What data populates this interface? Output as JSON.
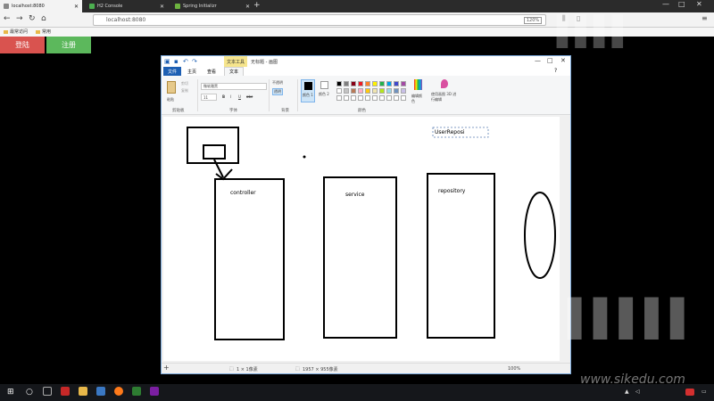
{
  "browser": {
    "tabs": [
      {
        "title": "localhost:8080",
        "active": true
      },
      {
        "title": "H2 Console",
        "active": false
      },
      {
        "title": "Spring Initializr",
        "active": false
      }
    ],
    "new_tab": "+",
    "url": "localhost:8080",
    "zoom": "120%",
    "bookmarks": [
      "最常访问",
      "常用"
    ],
    "window_controls": [
      "—",
      "□",
      "✕"
    ]
  },
  "page": {
    "login_button": "登陆",
    "register_button": "注册",
    "login_color": "#d9534f",
    "register_color": "#5cb85c"
  },
  "paint": {
    "context_tab": "文本工具",
    "title": "无标题 - 画图",
    "tabs": [
      "文件",
      "主页",
      "查看",
      "文本"
    ],
    "ribbon": {
      "clipboard_group": "剪贴板",
      "paste": "粘贴",
      "cut": "剪切",
      "copy": "复制",
      "font_group": "字体",
      "font_name": "微软雅黑",
      "font_size": "11",
      "background_group": "背景",
      "opaque": "不透明",
      "transparent": "透明",
      "colors_group": "颜色",
      "color1": "颜色 1",
      "color2": "颜色 2",
      "edit_colors": "编辑颜色",
      "paint3d": "使用画图 3D 进行编辑",
      "palette": [
        "#000000",
        "#7f7f7f",
        "#880015",
        "#ed1c24",
        "#ff7f27",
        "#fff200",
        "#22b14c",
        "#00a2e8",
        "#3f48cc",
        "#a349a4",
        "#ffffff",
        "#c3c3c3",
        "#b97a57",
        "#ffaec9",
        "#ffc90e",
        "#efe4b0",
        "#b5e61d",
        "#99d9ea",
        "#7092be",
        "#c8bfe7"
      ]
    },
    "canvas": {
      "boxes": [
        "controller",
        "service",
        "repository"
      ],
      "textbox": "UserReposi"
    },
    "status": {
      "selection": "1 × 1像素",
      "canvas_size": "1957 × 955像素",
      "zoom": "100%"
    }
  },
  "watermark": {
    "url": "www.sikedu.com"
  }
}
